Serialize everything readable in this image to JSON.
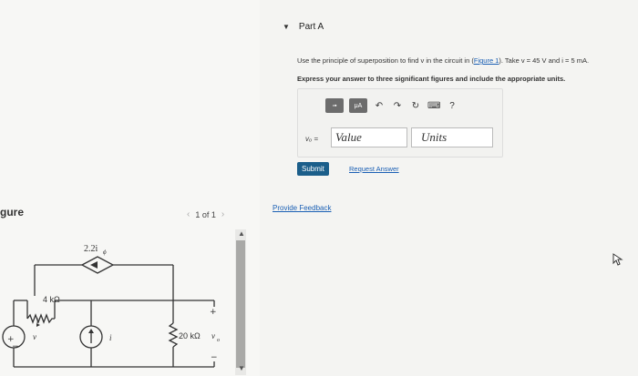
{
  "figure": {
    "label": "gure",
    "counter": "1 of 1",
    "prev": "‹",
    "next": "›"
  },
  "circuit": {
    "dep_source_label": "2.2i",
    "dep_source_sub": "ϕ",
    "resistor1": "4 kΩ",
    "current_label": "i",
    "current_sub": "ϕ",
    "vsource_label": "v",
    "isource_label": "i",
    "resistor2": "20 kΩ",
    "vo_label": "v",
    "vo_sub": "o",
    "plus": "+",
    "minus": "−"
  },
  "part": {
    "title": "Part A",
    "question_pre": "Use the principle of superposition to find v",
    "question_mid": " in the circuit in (",
    "figure_link": "Figure 1",
    "question_post": "). Take v = 45 V and i = 5 mA.",
    "instruction": "Express your answer to three significant figures and include the appropriate units.",
    "var_label": "vₒ =",
    "value_placeholder": "Value",
    "units_placeholder": "Units",
    "submit": "Submit",
    "request": "Request Answer"
  },
  "feedback": "Provide Feedback",
  "toolbar": {
    "btn1": "▫▪",
    "btn2": "μA",
    "undo": "↶",
    "redo": "↷",
    "reset": "↻",
    "keyboard": "⌨",
    "help": "?"
  }
}
